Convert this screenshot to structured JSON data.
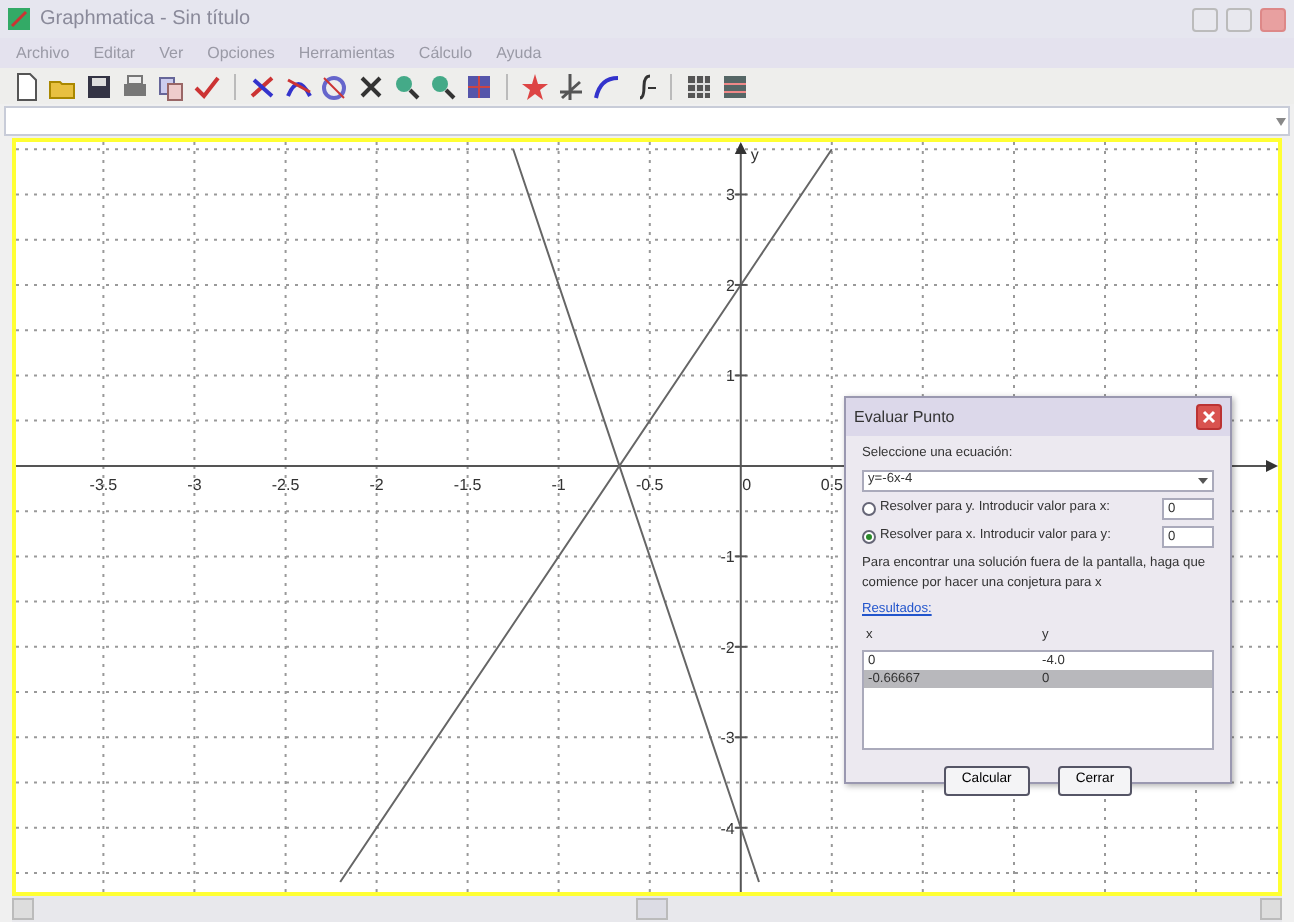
{
  "window": {
    "title": "Graphmatica - Sin título"
  },
  "menu": [
    "Archivo",
    "Editar",
    "Ver",
    "Opciones",
    "Herramientas",
    "Cálculo",
    "Ayuda"
  ],
  "graph": {
    "chart_data": {
      "type": "line",
      "ylabel": "y",
      "grid": true,
      "x": [
        -2.2,
        -1.25,
        0,
        0.1,
        0.5
      ],
      "series": [
        {
          "values": [
            null,
            3.5,
            -4,
            -4.6,
            null
          ]
        },
        {
          "values": [
            -4.6,
            -1.75,
            2,
            2.3,
            3.5
          ]
        }
      ],
      "xlim": [
        -3.98,
        2.95
      ],
      "ylim": [
        -4.71,
        3.58
      ],
      "xticks": [
        -3.5,
        -3,
        -2.5,
        -2,
        -1.5,
        -1,
        -0.5,
        {
          "value": 0,
          "label": "0"
        },
        0.5
      ],
      "yticks": [
        3,
        2,
        1,
        -1,
        -2,
        -3,
        -4
      ]
    }
  },
  "dialog": {
    "title": "Evaluar Punto",
    "equation_label": "Seleccione una ecuación:",
    "equation": "y=-6x-4",
    "options": [
      {
        "label": "Resolver para y. Introducir valor para x:",
        "value": "0",
        "selected": false
      },
      {
        "label": "Resolver para x. Introducir valor para y:",
        "value": "0",
        "selected": true
      }
    ],
    "hint": "Para encontrar una solución fuera de la pantalla, haga que comience por hacer una conjetura para x",
    "results_label": "Resultados:",
    "results_columns": [
      "x",
      "y"
    ],
    "results_rows": [
      {
        "cells": [
          "0",
          "-4.0"
        ],
        "selected": false
      },
      {
        "cells": [
          "-0.66667",
          "0"
        ],
        "selected": true
      }
    ],
    "buttons": [
      "Calcular",
      "Cerrar"
    ]
  }
}
